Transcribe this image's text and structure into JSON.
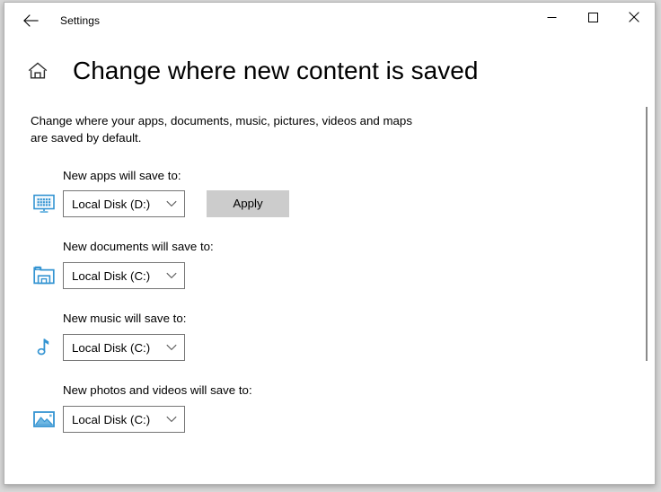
{
  "window": {
    "app_title": "Settings",
    "back_icon": "back-arrow-icon",
    "minimize_label": "Minimize",
    "maximize_label": "Maximize",
    "close_label": "Close"
  },
  "header": {
    "home_icon": "home-icon",
    "page_title": "Change where new content is saved"
  },
  "main": {
    "description": "Change where your apps, documents, music, pictures, videos and maps are saved by default.",
    "settings": [
      {
        "icon": "monitor-icon",
        "label": "New apps will save to:",
        "value": "Local Disk (D:)",
        "has_apply": true,
        "apply_label": "Apply"
      },
      {
        "icon": "save-folder-icon",
        "label": "New documents will save to:",
        "value": "Local Disk (C:)",
        "has_apply": false
      },
      {
        "icon": "music-note-icon",
        "label": "New music will save to:",
        "value": "Local Disk (C:)",
        "has_apply": false
      },
      {
        "icon": "picture-icon",
        "label": "New photos and videos will save to:",
        "value": "Local Disk (C:)",
        "has_apply": false
      }
    ]
  },
  "colors": {
    "accent_icon": "#3494d2",
    "button_face": "#cccccc",
    "combo_border": "#767676",
    "scrollbar_thumb": "#8a8a8a"
  }
}
